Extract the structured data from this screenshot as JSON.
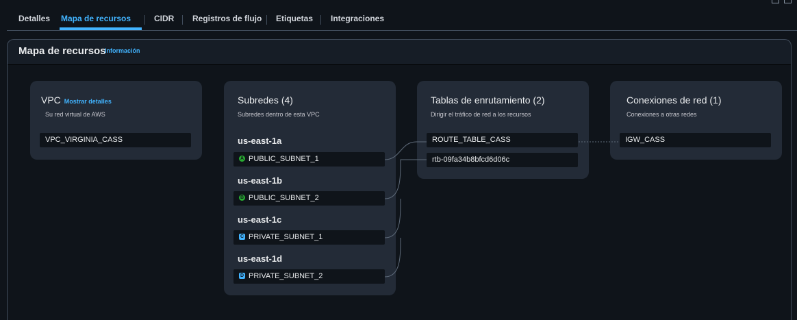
{
  "tabs": [
    {
      "label": "Detalles"
    },
    {
      "label": "Mapa de recursos",
      "active": true
    },
    {
      "label": "CIDR"
    },
    {
      "label": "Registros de flujo"
    },
    {
      "label": "Etiquetas"
    },
    {
      "label": "Integraciones"
    }
  ],
  "panel": {
    "title": "Mapa de recursos",
    "info_link": "Información"
  },
  "vpc_card": {
    "title": "VPC",
    "link": "Mostrar detalles",
    "subtitle": "Su red virtual de AWS",
    "item": "VPC_VIRGINIA_CASS"
  },
  "subnets_card": {
    "title": "Subredes (4)",
    "subtitle": "Subredes dentro de esta VPC",
    "zones": [
      {
        "name": "us-east-1a",
        "badge": "A",
        "subnet": "PUBLIC_SUBNET_1"
      },
      {
        "name": "us-east-1b",
        "badge": "B",
        "subnet": "PUBLIC_SUBNET_2"
      },
      {
        "name": "us-east-1c",
        "badge": "C",
        "subnet": "PRIVATE_SUBNET_1"
      },
      {
        "name": "us-east-1d",
        "badge": "D",
        "subnet": "PRIVATE_SUBNET_2"
      }
    ]
  },
  "route_tables_card": {
    "title": "Tablas de enrutamiento (2)",
    "subtitle": "Dirigir el tráfico de red a los recursos",
    "items": [
      "ROUTE_TABLE_CASS",
      "rtb-09fa34b8bfcd6d06c"
    ]
  },
  "network_card": {
    "title": "Conexiones de red (1)",
    "subtitle": "Conexiones a otras redes",
    "item": "IGW_CASS"
  },
  "colors": {
    "accent": "#42b4ff",
    "public_badge": "#29ad32",
    "private_badge": "#42b4ff",
    "card_bg": "#232b37",
    "page_bg": "#0f141a"
  }
}
